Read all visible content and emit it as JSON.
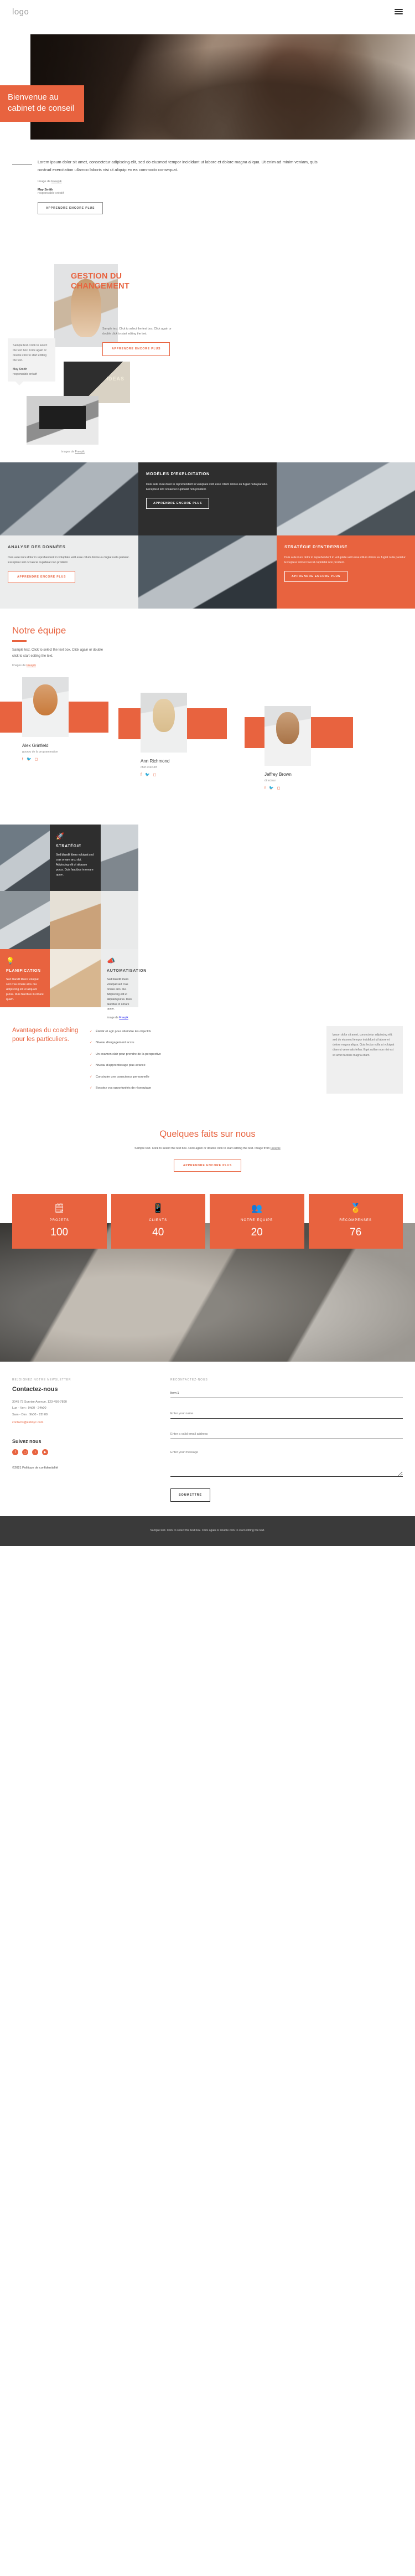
{
  "header": {
    "logo": "logo",
    "menu_icon": "hamburger-menu-icon"
  },
  "hero": {
    "title": "Bienvenue au cabinet de conseil"
  },
  "intro": {
    "paragraph": "Lorem ipsum dolor sit amet, consectetur adipiscing elit, sed do eiusmod tempor incididunt ut labore et dolore magna aliqua. Ut enim ad minim veniam, quis nostrud exercitation ullamco laboris nisi ut aliquip ex ea commodo consequat.",
    "credit_prefix": "Image de ",
    "credit_link": "Freepik",
    "author_name": "May Smith",
    "author_role": "responsable créatif",
    "button": "APPRENDRE ENCORE PLUS"
  },
  "change": {
    "title": "GESTION DU CHANGEMENT",
    "bubble": "Sample text. Click to select the text box. Click again or double click to start editing the text.",
    "bubble_author": "May Smith",
    "bubble_role": "responsable créatif",
    "right_text": "Sample text. Click to select the text box. Click again or double click to start editing the text.",
    "right_button": "APPRENDRE ENCORE PLUS",
    "credit_prefix": "Images de ",
    "credit_link": "Freepik"
  },
  "tiles": [
    {
      "kind": "image",
      "name": "business-team-photo"
    },
    {
      "kind": "dark",
      "title": "MODÈLES D'EXPLOITATION",
      "text": "Duis aute irure dolor in reprehenderit in voluptate velit esse cillum dolore eu fugiat nulla pariatur. Excepteur sint occaecat cupidatat non proident.",
      "button": "APPRENDRE ENCORE PLUS"
    },
    {
      "kind": "image",
      "name": "meeting-photo"
    },
    {
      "kind": "light",
      "title": "ANALYSE DES DONNÉES",
      "text": "Duis aute irure dolor in reprehenderit in voluptate velit esse cillum dolore eu fugiat nulla pariatur. Excepteur sint occaecat cupidatat non proident.",
      "button": "APPRENDRE ENCORE PLUS"
    },
    {
      "kind": "image",
      "name": "consultant-portrait-photo"
    },
    {
      "kind": "orange",
      "title": "STRATÉGIE D'ENTREPRISE",
      "text": "Duis aute irure dolor in reprehenderit in voluptate velit esse cillum dolore eu fugiat nulla pariatur. Excepteur sint occaecat cupidatat non proident.",
      "button": "APPRENDRE ENCORE PLUS"
    }
  ],
  "team": {
    "title": "Notre équipe",
    "subtitle": "Sample text. Click to select the text box. Click again or double click to start editing the text.",
    "credit_prefix": "Images de ",
    "credit_link": "Freepik",
    "members": [
      {
        "name": "Alex Grinfield",
        "role": "gourou de la programmation",
        "socials": [
          "facebook-icon",
          "twitter-icon",
          "instagram-icon"
        ]
      },
      {
        "name": "Ann Richmond",
        "role": "chef exécutif",
        "socials": [
          "facebook-icon",
          "twitter-icon",
          "instagram-icon"
        ]
      },
      {
        "name": "Jeffrey Brown",
        "role": "directeur",
        "socials": [
          "facebook-icon",
          "twitter-icon",
          "instagram-icon"
        ]
      }
    ]
  },
  "mosaic": {
    "strategy": {
      "icon": "rocket-icon",
      "title": "STRATÉGIE",
      "text": "Sed blandit libero volutpat sed cras ornare arcu dui. Adipiscing elit ut aliquam purus. Duis faucibus in ornare quam."
    },
    "planning": {
      "icon": "lightbulb-icon",
      "title": "PLANIFICATION",
      "text": "Sed blandit libero volutpat sed cras ornare arcu dui. Adipiscing elit ut aliquam purus. Duis faucibus in ornare quam."
    },
    "automation": {
      "icon": "megaphone-icon",
      "title": "AUTOMATISATION",
      "text": "Sed blandit libero volutpat sed cras ornare arcu dui. Adipiscing elit ut aliquam purus. Duis faucibus in ornare quam.",
      "credit_prefix": "Image de ",
      "credit_link": "Freepik"
    }
  },
  "advantages": {
    "title": "Avantages du coaching pour les particuliers.",
    "items": [
      "Établir et agir pour atteindre les objectifs",
      "Niveau d'engagement accru",
      "Un examen clair pour prendre de la perspective",
      "Niveau d'apprentissage plus avancé",
      "Construire une conscience personnelle",
      "Boostez vos opportunités de réseautage"
    ],
    "note": "Ipsum dolor sit amet, consectetur adipiscing elit, sed do eiusmod tempor incididunt ut labore et dolore magna aliqua. Quis lectus nulla at volutpat diam ut venenatis tellus. Eget nullam non nisi est sit amet facilisis magna etiam."
  },
  "facts": {
    "title": "Quelques faits sur nous",
    "subtitle": "Sample text. Click to select the text box. Click again or double click to start editing the text. Image from ",
    "subtitle_link": "Freepik",
    "button": "APPRENDRE ENCORE PLUS",
    "stats": [
      {
        "icon": "design-projects-icon",
        "label": "PROJETS",
        "value": "100"
      },
      {
        "icon": "mobile-touch-icon",
        "label": "CLIENTS",
        "value": "40"
      },
      {
        "icon": "people-group-icon",
        "label": "NOTRE ÉQUIPE",
        "value": "20"
      },
      {
        "icon": "award-badge-icon",
        "label": "RÉCOMPENSES",
        "value": "76"
      }
    ]
  },
  "contact": {
    "left_eyebrow": "REJOIGNEZ NOTRE NEWSLETTER",
    "heading": "Contactez-nous",
    "address": "3045 73 Sunrise Avenue, 123-456-7890",
    "hours_week": "Lun - Ven : 9h00 - 24h00",
    "hours_weekend": "Sam - Dim : 9h00 - 22h00",
    "email": "contacts@esbnyc.com",
    "follow_heading": "Suivez nous",
    "socials": [
      "facebook-icon",
      "instagram-icon",
      "twitter-icon",
      "youtube-icon"
    ],
    "copyright": "©2021 Politique de confidentialité",
    "right_eyebrow": "RECONTACTEZ-NOUS",
    "select_value": "Item 1",
    "name_placeholder": "Enter your name",
    "email_placeholder": "Enter a valid email address",
    "message_placeholder": "Enter your message",
    "submit": "SOUMETTRE"
  },
  "footbar": {
    "text": "Sample text. Click to select the text box. Click again or double click to start editing the text."
  },
  "colors": {
    "accent": "#e8633f",
    "dark": "#2e2e2e",
    "light": "#eceded"
  }
}
